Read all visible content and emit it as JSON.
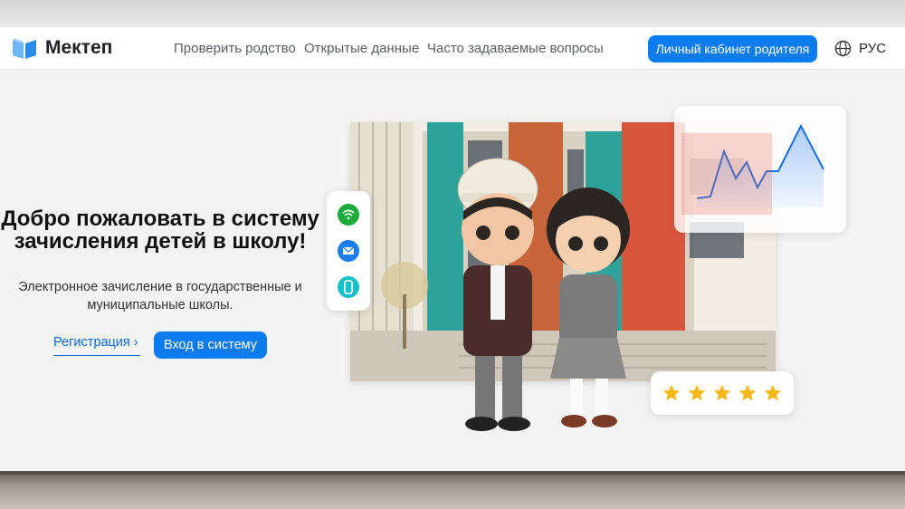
{
  "brand": {
    "name": "Мектеп",
    "logo_icon": "book-icon",
    "accent": "#0a7cf0"
  },
  "nav": {
    "items": [
      "Проверить родство",
      "Открытые данные",
      "Часто задаваемые вопросы"
    ],
    "parent_cabinet": "Личный кабинет родителя",
    "language": "РУС",
    "language_icon": "globe-icon"
  },
  "hero": {
    "title": "Добро пожаловать в систему зачисления детей в школу!",
    "subtitle": "Электронное зачисление в государственные и муниципальные школы.",
    "register_label": "Регистрация",
    "login_label": "Вход в систему"
  },
  "side_icons": [
    "wifi-icon",
    "mail-icon",
    "phone-icon"
  ],
  "rating": {
    "stars": 5,
    "max": 5,
    "color": "#f5b81b"
  }
}
